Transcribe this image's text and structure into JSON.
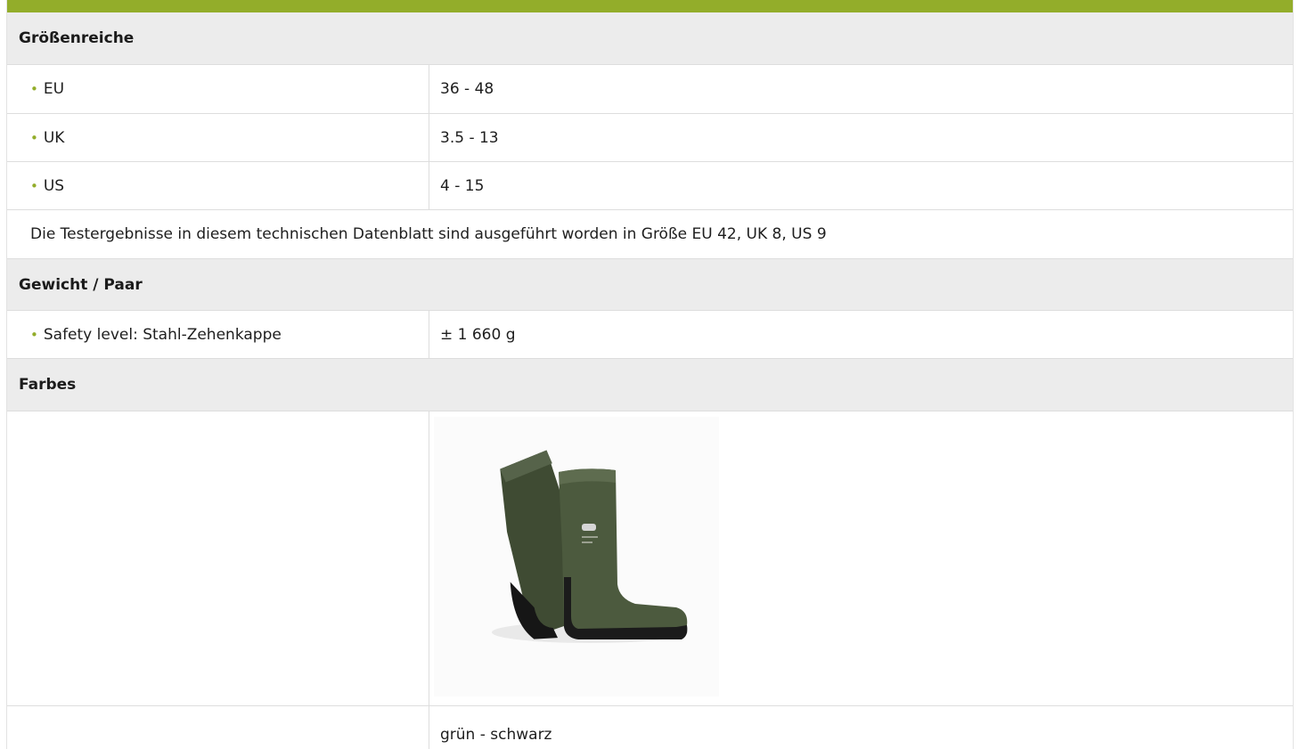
{
  "sections": {
    "sizes": {
      "title": "Größenreiche",
      "rows": [
        {
          "label": "EU",
          "value": "36 - 48"
        },
        {
          "label": "UK",
          "value": "3.5 - 13"
        },
        {
          "label": "US",
          "value": "4 - 15"
        }
      ],
      "note": "Die Testergebnisse in diesem technischen Datenblatt sind ausgeführt worden in Größe EU 42, UK 8, US 9"
    },
    "weight": {
      "title": "Gewicht / Paar",
      "rows": [
        {
          "label": "Safety level: Stahl-Zehenkappe",
          "value": "± 1 660 g"
        }
      ]
    },
    "colors": {
      "title": "Farbes",
      "color_name": "grün - schwarz",
      "image_icon": "rubber-boot-icon"
    }
  },
  "colors": {
    "accent": "#93ad2a",
    "header_bg": "#ececec",
    "border": "#dddddd",
    "boot_green": "#4c5a3e",
    "boot_sole": "#1a1a1a"
  }
}
